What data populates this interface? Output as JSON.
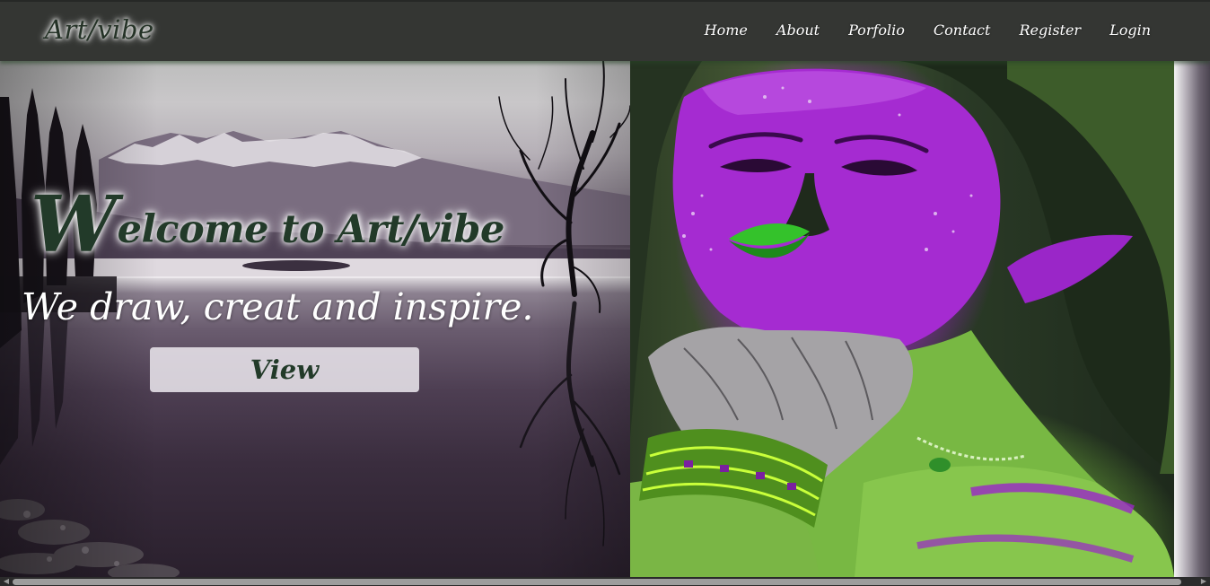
{
  "navbar": {
    "brand": "Art/vibe",
    "links": [
      {
        "label": "Home"
      },
      {
        "label": "About"
      },
      {
        "label": "Porfolio"
      },
      {
        "label": "Contact"
      },
      {
        "label": "Register"
      },
      {
        "label": "Login"
      }
    ]
  },
  "hero": {
    "title_first_letter": "W",
    "title_rest": "elcome to Art/vibe",
    "subtitle": "We draw, creat and inspire.",
    "button_label": "View"
  },
  "colors": {
    "navbar_bg": "#343633",
    "title_text": "#223a29",
    "button_bg": "#e8e4ea",
    "accent_purple": "#a52bd1",
    "accent_green": "#6fae3a"
  },
  "icons": {
    "scroll_left": "left-arrow-icon",
    "scroll_right": "right-arrow-icon"
  }
}
